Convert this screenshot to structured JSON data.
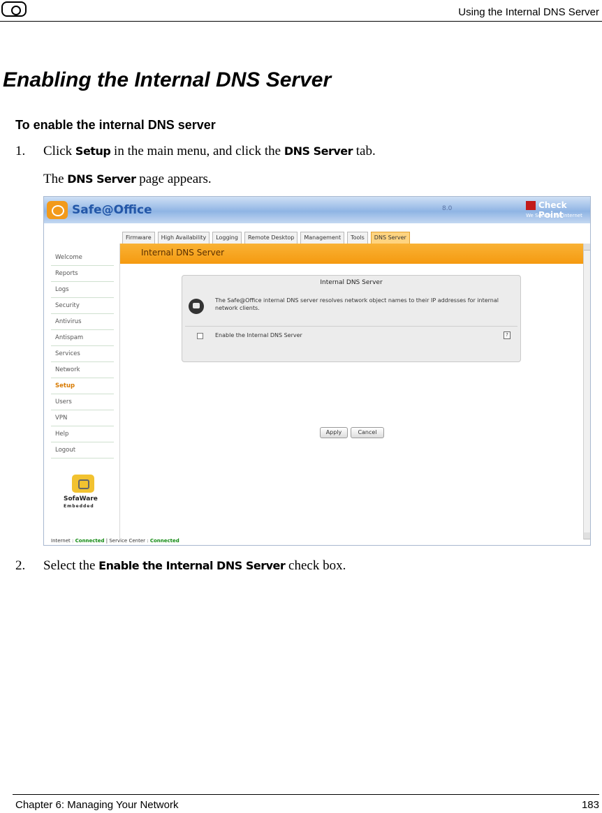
{
  "header": {
    "title": "Using the Internal DNS Server"
  },
  "heading": "Enabling the Internal DNS Server",
  "subheading": "To enable the internal DNS server",
  "steps": [
    {
      "num": "1.",
      "text_pre": "Click ",
      "ui1": "Setup",
      "text_mid": " in the main menu, and click the ",
      "ui2": "DNS Server",
      "text_post": " tab."
    },
    {
      "text_pre": "The ",
      "ui1": "DNS Server",
      "text_post": " page appears."
    },
    {
      "num": "2.",
      "text_pre": "Select the ",
      "ui1": "Enable the Internal DNS Server",
      "text_post": " check box."
    }
  ],
  "screenshot": {
    "brand": "Safe@Office",
    "version": "8.0",
    "vendor": "Check Point",
    "vendor_tagline": "We Secure the Internet",
    "tabs": [
      "Firmware",
      "High Availability",
      "Logging",
      "Remote Desktop",
      "Management",
      "Tools",
      "DNS Server"
    ],
    "active_tab": "DNS Server",
    "menu": [
      "Welcome",
      "Reports",
      "Logs",
      "Security",
      "Antivirus",
      "Antispam",
      "Services",
      "Network",
      "Setup",
      "Users",
      "VPN",
      "Help",
      "Logout"
    ],
    "active_menu": "Setup",
    "page_title": "Internal DNS Server",
    "panel": {
      "title": "Internal DNS Server",
      "description": "The Safe@Office internal DNS server resolves network object names to their IP addresses for internal network clients.",
      "checkbox_label": "Enable the Internal DNS Server",
      "checkbox_checked": false,
      "help_icon": "help-icon"
    },
    "buttons": {
      "apply": "Apply",
      "cancel": "Cancel"
    },
    "footer_logo": {
      "name": "SofaWare",
      "sub": "Embedded"
    },
    "status": {
      "internet_label": "Internet :",
      "internet_value": "Connected",
      "service_label": "Service Center :",
      "service_value": "Connected"
    }
  },
  "footer": {
    "chapter": "Chapter 6: Managing Your Network",
    "page": "183"
  }
}
